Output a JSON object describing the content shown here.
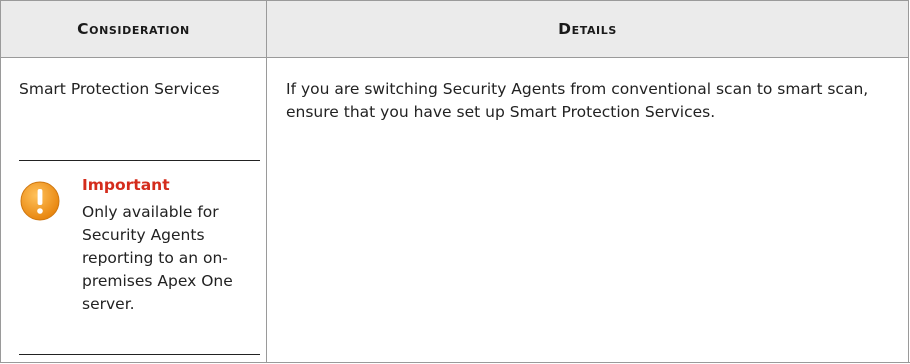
{
  "table": {
    "headers": [
      "Consideration",
      "Details"
    ],
    "row": {
      "consideration": "Smart Protection Services",
      "details": "If you are switching Security Agents from conventional scan to smart scan, ensure that you have set up Smart Protection Services."
    },
    "note": {
      "icon": "warning-icon",
      "title": "Important",
      "text": "Only available for Security Agents reporting to an on-premises Apex One server."
    }
  },
  "colors": {
    "header_bg": "#ebebeb",
    "important_title": "#d42c1c",
    "icon_orange": "#f39a1c"
  }
}
